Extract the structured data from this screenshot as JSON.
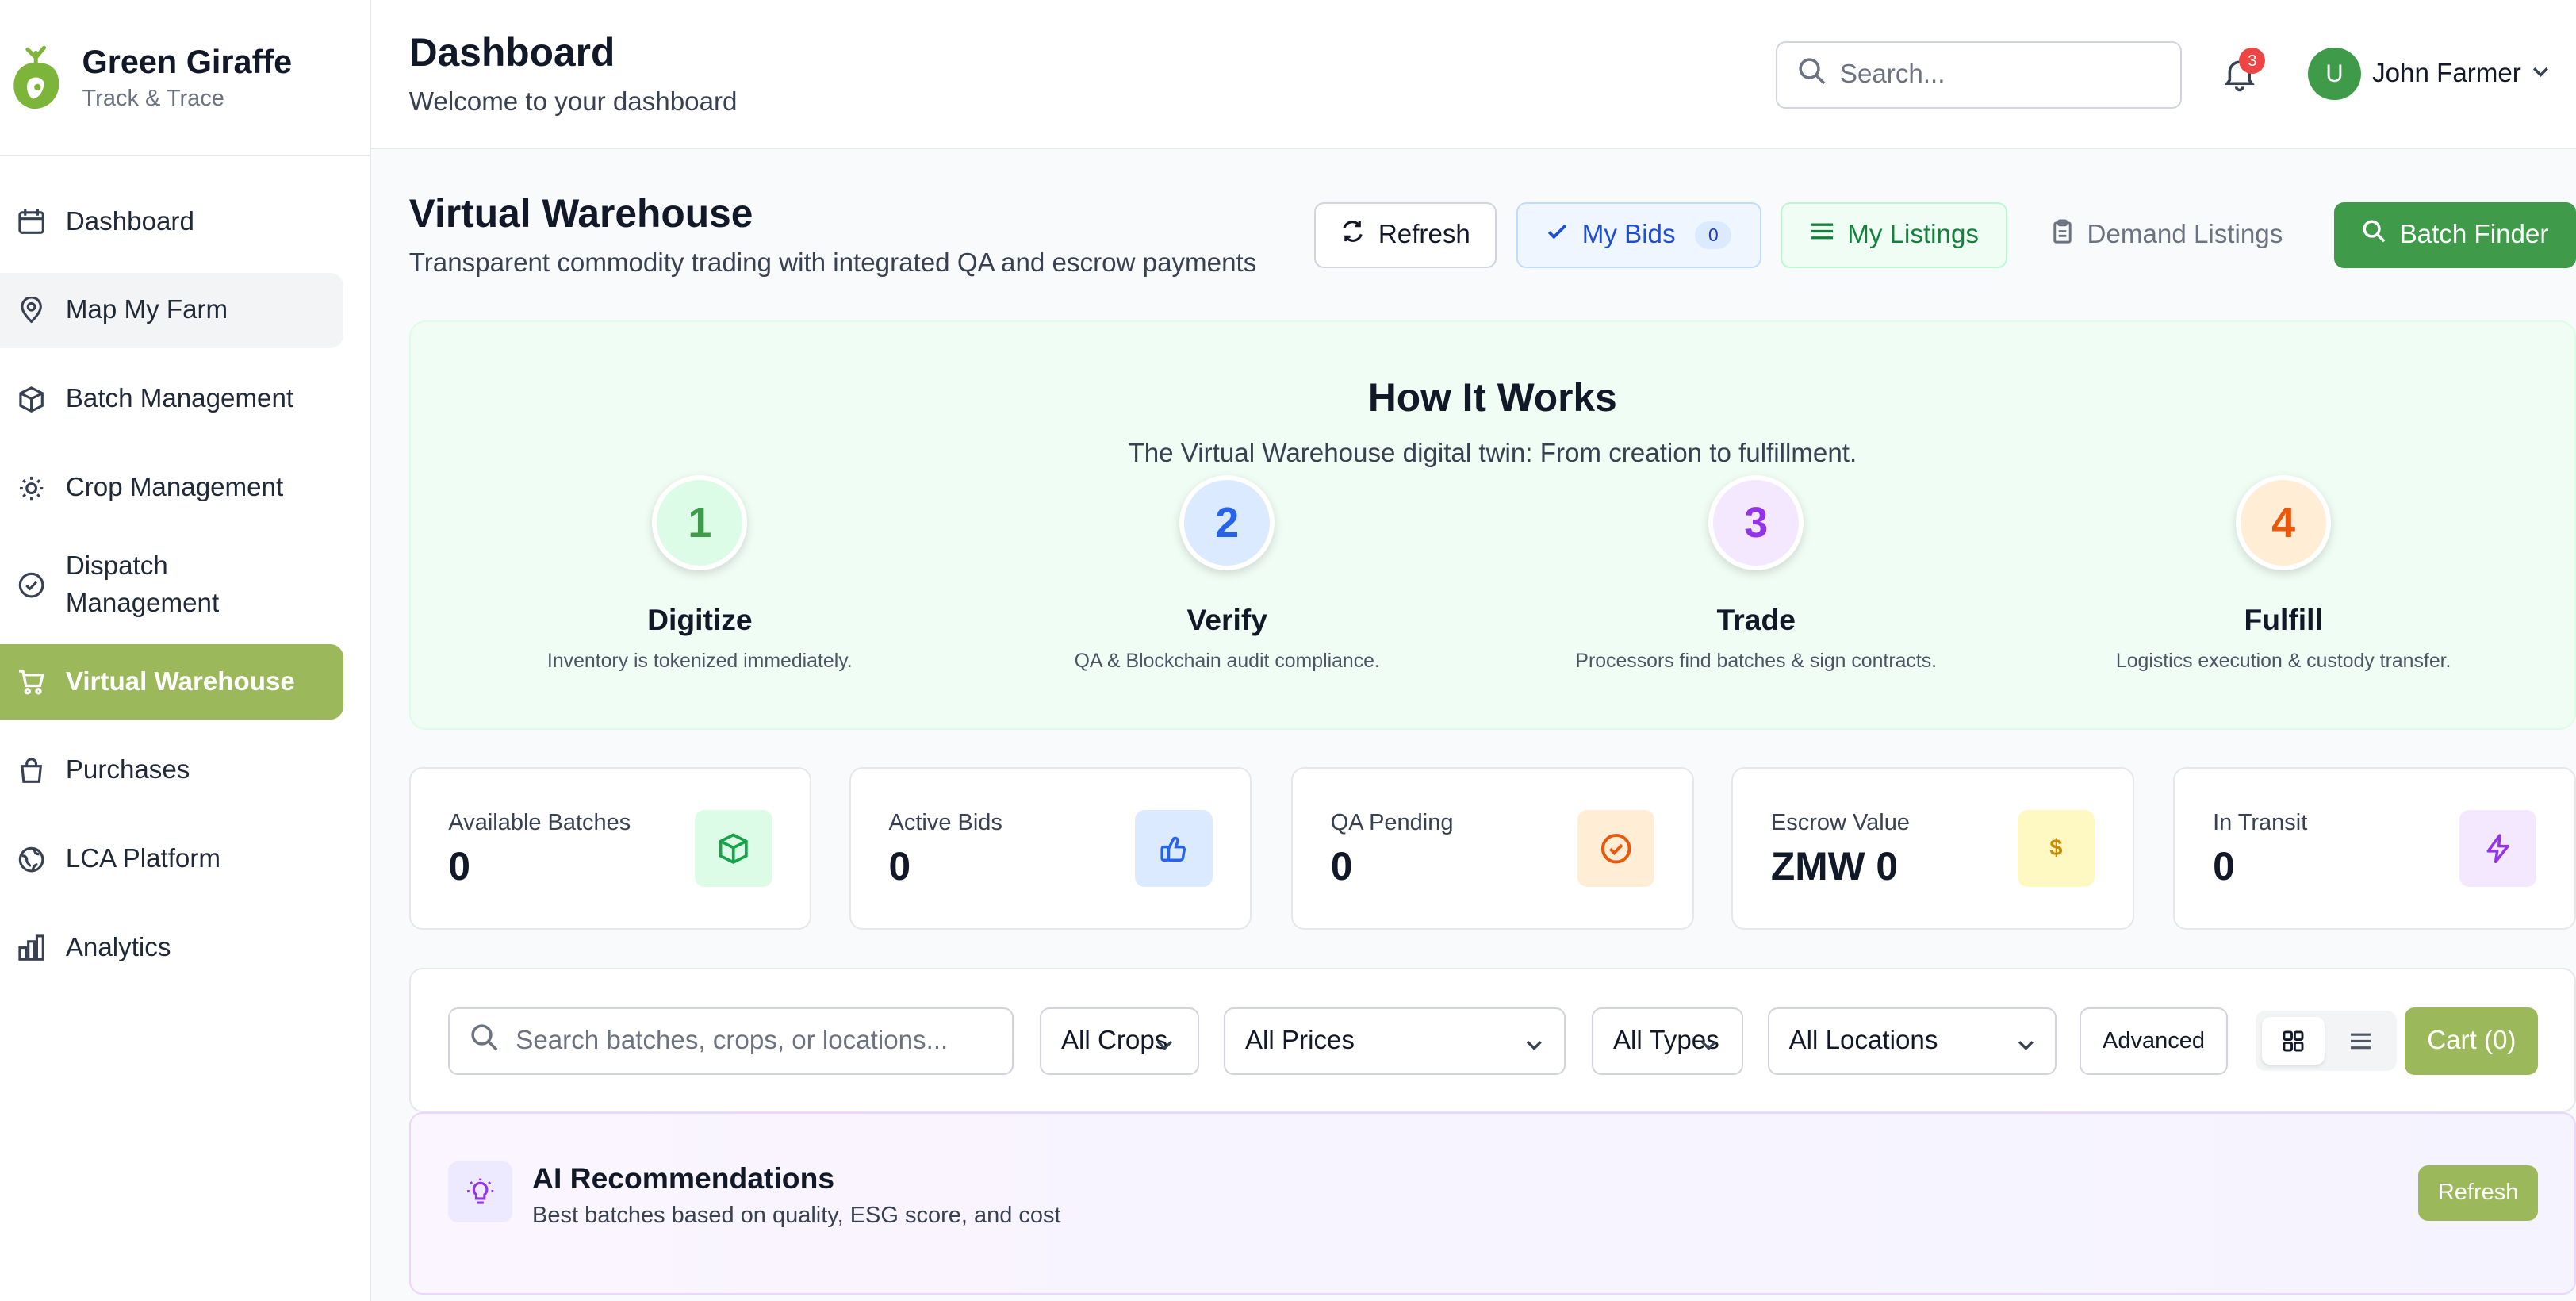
{
  "brand": {
    "name": "Green Giraffe",
    "tagline": "Track & Trace"
  },
  "sidebar": {
    "items": [
      {
        "label": "Dashboard",
        "icon": "calendar-icon"
      },
      {
        "label": "Map My Farm",
        "icon": "map-pin-icon"
      },
      {
        "label": "Batch Management",
        "icon": "box-icon"
      },
      {
        "label": "Crop Management",
        "icon": "sun-icon"
      },
      {
        "label": "Dispatch Management",
        "icon": "check-circle-icon"
      },
      {
        "label": "Virtual Warehouse",
        "icon": "cart-icon"
      },
      {
        "label": "Purchases",
        "icon": "bag-icon"
      },
      {
        "label": "LCA Platform",
        "icon": "globe-icon"
      },
      {
        "label": "Analytics",
        "icon": "bar-chart-icon"
      }
    ]
  },
  "header": {
    "title": "Dashboard",
    "subtitle": "Welcome to your dashboard",
    "search_placeholder": "Search...",
    "notification_count": "3",
    "user_initial": "U",
    "user_name": "John Farmer"
  },
  "warehouse": {
    "title": "Virtual Warehouse",
    "subtitle": "Transparent commodity trading with integrated QA and escrow payments",
    "buttons": {
      "refresh": "Refresh",
      "my_bids": "My Bids",
      "my_bids_count": "0",
      "my_listings": "My Listings",
      "demand_listings": "Demand Listings",
      "batch_finder": "Batch Finder"
    }
  },
  "how_it_works": {
    "title": "How It Works",
    "subtitle": "The Virtual Warehouse digital twin: From creation to fulfillment.",
    "steps": [
      {
        "number": "1",
        "name": "Digitize",
        "desc": "Inventory is tokenized immediately."
      },
      {
        "number": "2",
        "name": "Verify",
        "desc": "QA & Blockchain audit compliance."
      },
      {
        "number": "3",
        "name": "Trade",
        "desc": "Processors find batches & sign contracts."
      },
      {
        "number": "4",
        "name": "Fulfill",
        "desc": "Logistics execution & custody transfer."
      }
    ]
  },
  "stats": [
    {
      "label": "Available Batches",
      "value": "0"
    },
    {
      "label": "Active Bids",
      "value": "0"
    },
    {
      "label": "QA Pending",
      "value": "0"
    },
    {
      "label": "Escrow Value",
      "value": "ZMW 0"
    },
    {
      "label": "In Transit",
      "value": "0"
    }
  ],
  "filters": {
    "search_placeholder": "Search batches, crops, or locations...",
    "crops": "All Crops",
    "prices": "All Prices",
    "types": "All Types",
    "locations": "All Locations",
    "advanced": "Advanced",
    "cart": "Cart (0)"
  },
  "ai": {
    "title": "AI Recommendations",
    "subtitle": "Best batches based on quality, ESG score, and cost",
    "refresh": "Refresh"
  },
  "colors": {
    "accent": "#9bb95a",
    "brand_green": "#3f9b4a"
  }
}
